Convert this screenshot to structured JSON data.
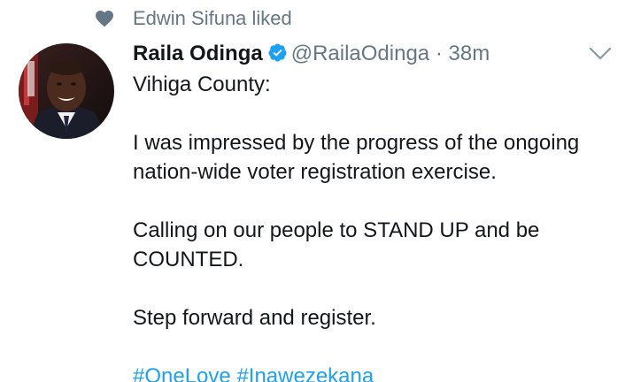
{
  "social_context": {
    "text": "Edwin Sifuna liked",
    "icon": "heart-icon"
  },
  "tweet": {
    "author_name": "Raila Odinga",
    "verified": true,
    "handle": "@RailaOdinga",
    "separator": "·",
    "timestamp": "38m",
    "menu_icon": "chevron-down-icon",
    "body": {
      "location": "Vihiga County:",
      "paragraph_1_line_1": "I was impressed by the progress of the ongoing",
      "paragraph_1_line_2": "nation-wide voter registration exercise.",
      "paragraph_2_line_1": "Calling on our people to STAND UP and be",
      "paragraph_2_line_2": "COUNTED.",
      "paragraph_3": "Step forward and register.",
      "hashtags": [
        "#OneLove",
        "#Inawezekana"
      ]
    }
  },
  "colors": {
    "text_primary": "#14171a",
    "text_secondary": "#657786",
    "link": "#1da1f2",
    "verified": "#1da1f2",
    "icon_gray": "#657786"
  }
}
